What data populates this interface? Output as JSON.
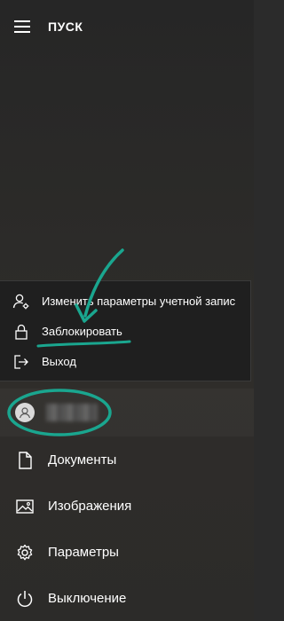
{
  "header": {
    "title": "ПУСК",
    "menu_icon": "hamburger-icon"
  },
  "account_menu": {
    "items": [
      {
        "label": "Изменить параметры учетной запис",
        "icon": "account-settings-icon"
      },
      {
        "label": "Заблокировать",
        "icon": "lock-icon"
      },
      {
        "label": "Выход",
        "icon": "sign-out-icon"
      }
    ]
  },
  "user": {
    "avatar_icon": "user-avatar-icon"
  },
  "nav": {
    "items": [
      {
        "label": "Документы",
        "icon": "document-icon"
      },
      {
        "label": "Изображения",
        "icon": "pictures-icon"
      },
      {
        "label": "Параметры",
        "icon": "gear-icon"
      },
      {
        "label": "Выключение",
        "icon": "power-icon"
      }
    ]
  },
  "colors": {
    "background": "#2b2b2b",
    "popup_background": "#1f1f1f",
    "annotation": "#1aa68f",
    "text": "#ffffff"
  }
}
